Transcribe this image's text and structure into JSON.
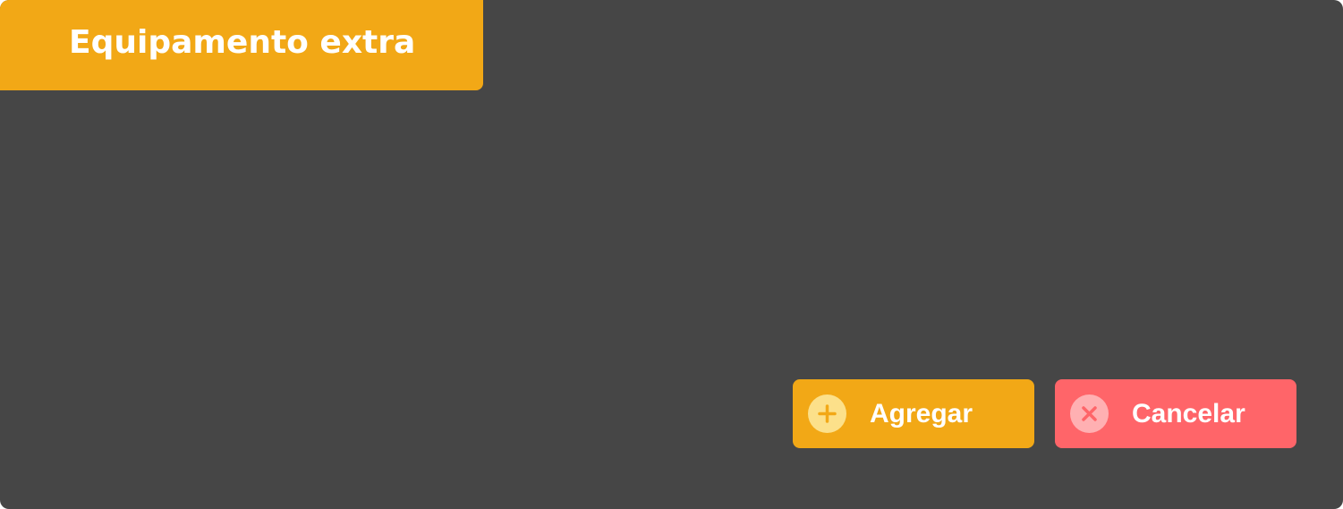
{
  "dialog": {
    "title": "Equipamento extra",
    "actions": {
      "add": {
        "label": "Agregar",
        "icon": "plus-icon"
      },
      "cancel": {
        "label": "Cancelar",
        "icon": "close-icon"
      }
    }
  },
  "colors": {
    "background": "#464646",
    "accent": "#F2A816",
    "danger": "#FF6569",
    "add_icon_bg": "#FCE08A",
    "cancel_icon_bg": "#FFB0B2",
    "text": "#FFFFFF"
  }
}
